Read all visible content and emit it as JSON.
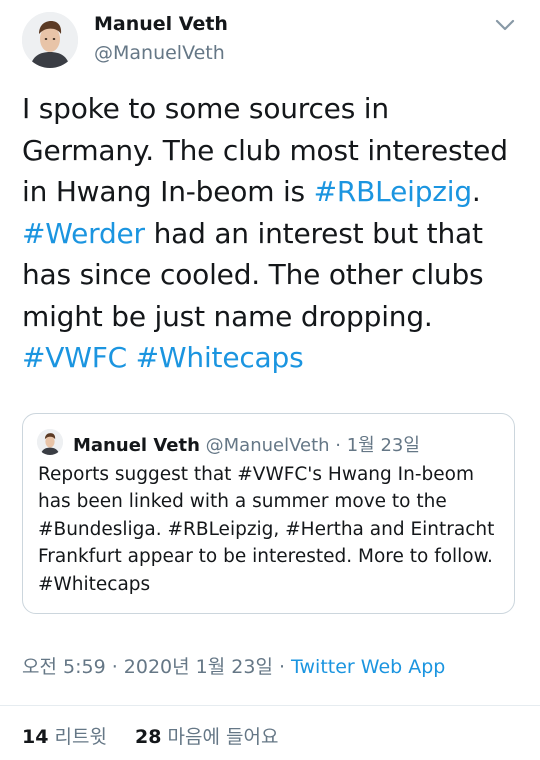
{
  "tweet": {
    "author_name": "Manuel Veth",
    "author_handle": "@ManuelVeth",
    "text_lines": [
      [
        {
          "t": "I spoke to some sources in",
          "tag": false
        }
      ],
      [
        {
          "t": "Germany. The club most interested",
          "tag": false
        }
      ],
      [
        {
          "t": "in Hwang In-beom is ",
          "tag": false
        },
        {
          "t": "#RBLeipzig",
          "tag": true
        },
        {
          "t": ".",
          "tag": false
        }
      ],
      [
        {
          "t": "#Werder",
          "tag": true
        },
        {
          "t": " had an interest but that",
          "tag": false
        }
      ],
      [
        {
          "t": "has since cooled. The other clubs",
          "tag": false
        }
      ],
      [
        {
          "t": "might be just name dropping.",
          "tag": false
        }
      ],
      [
        {
          "t": "#VWFC",
          "tag": true
        },
        {
          "t": " ",
          "tag": false
        },
        {
          "t": "#Whitecaps",
          "tag": true
        }
      ]
    ],
    "timestamp": "오전 5:59 · 2020년 1월 23일 · ",
    "source": "Twitter Web App",
    "retweets_count": "14",
    "retweets_label": "리트윗",
    "likes_count": "28",
    "likes_label": "마음에 들어요",
    "link_color": "#1b95e0",
    "more_icon": "chevron-down-icon"
  },
  "quoted_tweet": {
    "author_name": "Manuel Veth",
    "meta": "@ManuelVeth · 1월 23일",
    "text_lines": [
      "Reports suggest that #VWFC's Hwang In-beom",
      "has been linked with a summer move to the",
      "#Bundesliga. #RBLeipzig, #Hertha and Eintracht",
      "Frankfurt appear to be interested. More to follow.",
      "#Whitecaps"
    ]
  }
}
